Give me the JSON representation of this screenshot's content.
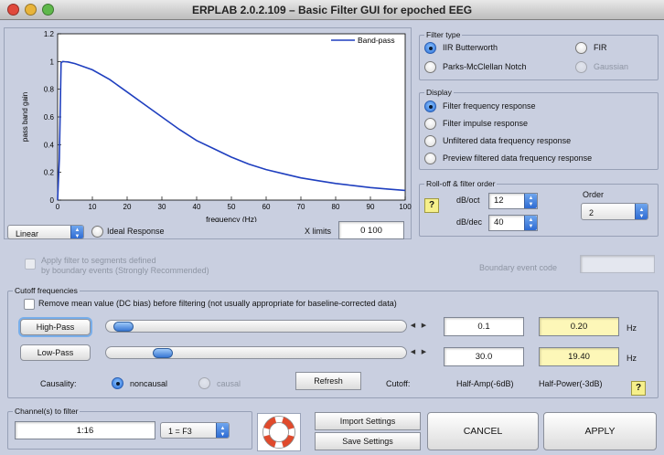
{
  "window": {
    "title": "ERPLAB 2.0.2.109   –   Basic Filter GUI for epoched EEG"
  },
  "plot": {
    "ylabel": "pass band gain",
    "xlabel": "frequency (Hz)",
    "legend": "Band-pass",
    "scale_select": "Linear",
    "ideal_response_label": "Ideal Response",
    "xlimits_label": "X limits",
    "xlimits_value": "0  100"
  },
  "chart_data": {
    "type": "line",
    "xlim": [
      0,
      100
    ],
    "ylim": [
      0,
      1.2
    ],
    "xticks": [
      "0",
      "10",
      "20",
      "30",
      "40",
      "50",
      "60",
      "70",
      "80",
      "90",
      "100"
    ],
    "yticks": [
      "0",
      "0.2",
      "0.4",
      "0.6",
      "0.8",
      "1",
      "1.2"
    ],
    "grid": false,
    "legend_position": "top-right",
    "series": [
      {
        "name": "Band-pass",
        "color": "#1f3fbf",
        "x": [
          0,
          0.5,
          1,
          1.5,
          2,
          3,
          5,
          10,
          15,
          20,
          25,
          30,
          35,
          40,
          45,
          50,
          55,
          60,
          65,
          70,
          75,
          80,
          85,
          90,
          95,
          100
        ],
        "y": [
          0,
          0.3,
          0.99,
          1.0,
          0.999,
          0.997,
          0.985,
          0.94,
          0.87,
          0.78,
          0.69,
          0.6,
          0.51,
          0.43,
          0.37,
          0.31,
          0.26,
          0.22,
          0.19,
          0.16,
          0.14,
          0.12,
          0.105,
          0.09,
          0.08,
          0.07
        ]
      }
    ]
  },
  "filter_type": {
    "title": "Filter type",
    "options": [
      "IIR Butterworth",
      "FIR",
      "Parks-McClellan Notch",
      "Gaussian"
    ]
  },
  "display": {
    "title": "Display",
    "options": [
      "Filter frequency response",
      "Filter impulse response",
      "Unfiltered data frequency response",
      "Preview filtered data frequency response"
    ]
  },
  "rolloff": {
    "title": "Roll-off & filter order",
    "help": "?",
    "dboct_label": "dB/oct",
    "dboct_value": "12",
    "dbdec_label": "dB/dec",
    "dbdec_value": "40",
    "order_label": "Order",
    "order_value": "2"
  },
  "segments": {
    "apply_label_1": "Apply filter to segments defined",
    "apply_label_2": "by boundary events (Strongly Recommended)",
    "boundary_label": "Boundary event code",
    "boundary_value": ""
  },
  "cutoff": {
    "title": "Cutoff frequencies",
    "remove_mean": "Remove mean value (DC bias) before filtering (not usually appropriate for baseline-corrected data)",
    "highpass_label": "High-Pass",
    "lowpass_label": "Low-Pass",
    "highpass_slider_position": 0.02,
    "lowpass_slider_position": 0.16,
    "highpass_value": "0.1",
    "lowpass_value": "30.0",
    "highpass_power": "0.20",
    "lowpass_power": "19.40",
    "hz1": "Hz",
    "hz2": "Hz",
    "causality_label": "Causality:",
    "noncausal": "noncausal",
    "causal": "causal",
    "refresh": "Refresh",
    "cutoff_label": "Cutoff:",
    "half_amp": "Half-Amp(-6dB)",
    "half_power": "Half-Power(-3dB)",
    "help": "?"
  },
  "channels": {
    "title": "Channel(s) to filter",
    "value": "1:16",
    "select": "1 = F3"
  },
  "actions": {
    "import": "Import Settings",
    "save": "Save Settings",
    "cancel": "CANCEL",
    "apply": "APPLY"
  },
  "arrows": {
    "left": "◀",
    "right": "▶",
    "up": "▲",
    "down": "▼"
  },
  "colors": {
    "background": "#c9cfe0",
    "accent": "#2a6ed8",
    "highlight": "#fdf7b8",
    "curve": "#1f3fbf"
  }
}
